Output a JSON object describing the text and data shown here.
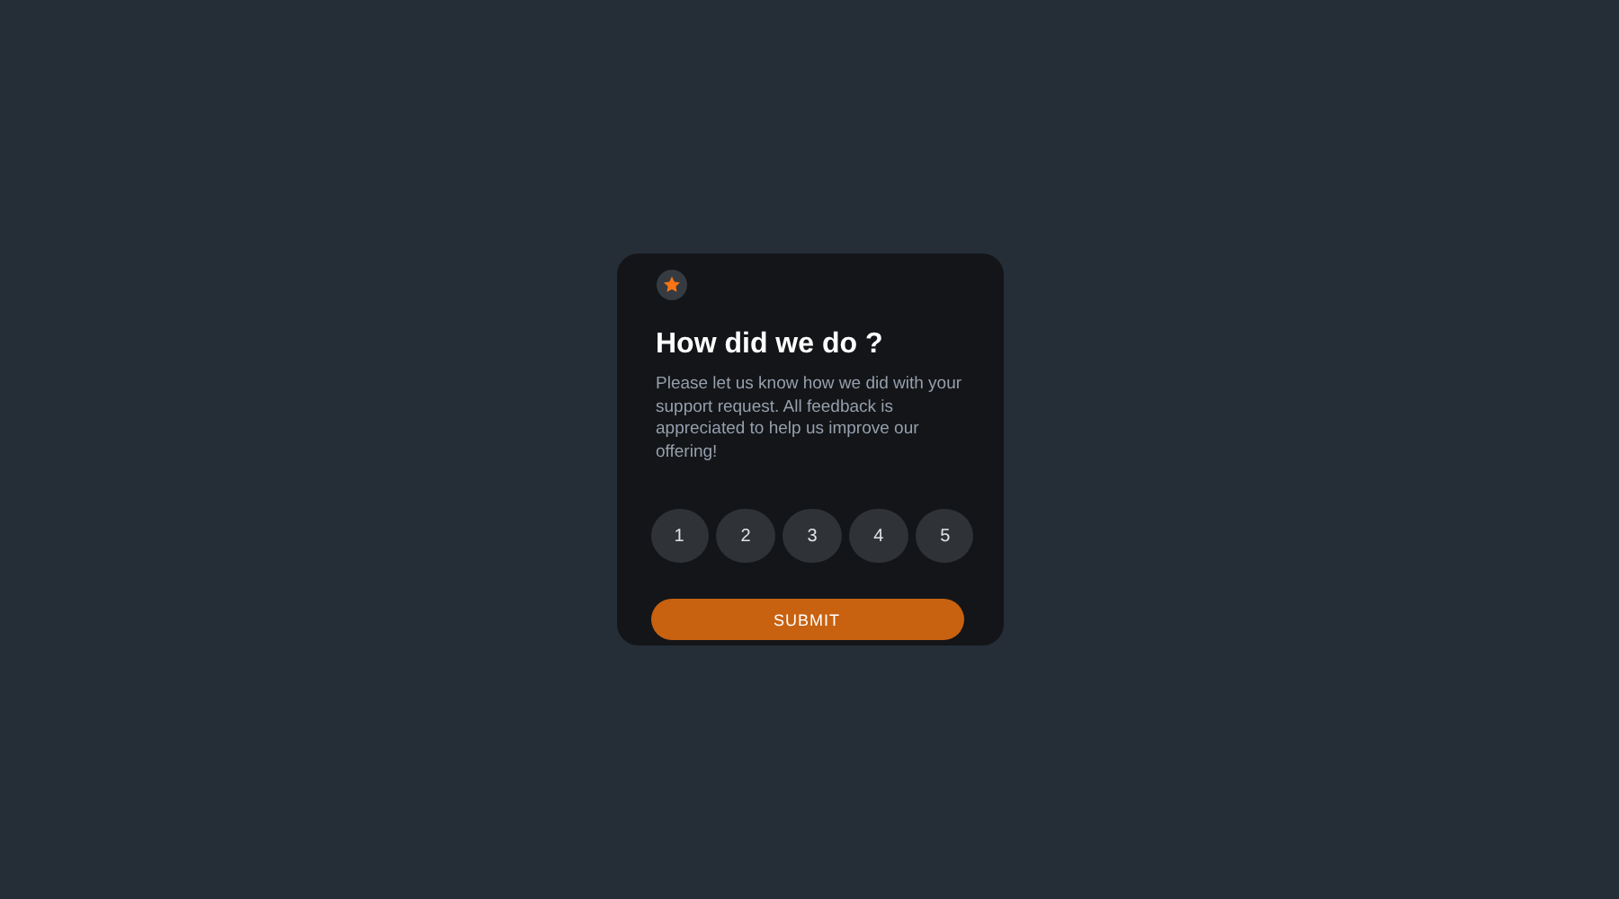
{
  "card": {
    "title": "How did we do ?",
    "description": "Please let us know how we did with your support request. All feedback is appreciated to help us improve our offering!",
    "ratings": [
      {
        "label": "1",
        "selected": false
      },
      {
        "label": "2",
        "selected": false
      },
      {
        "label": "3",
        "selected": false
      },
      {
        "label": "4",
        "selected": false
      },
      {
        "label": "5",
        "selected": false
      }
    ],
    "submit": "SUBMIT"
  }
}
